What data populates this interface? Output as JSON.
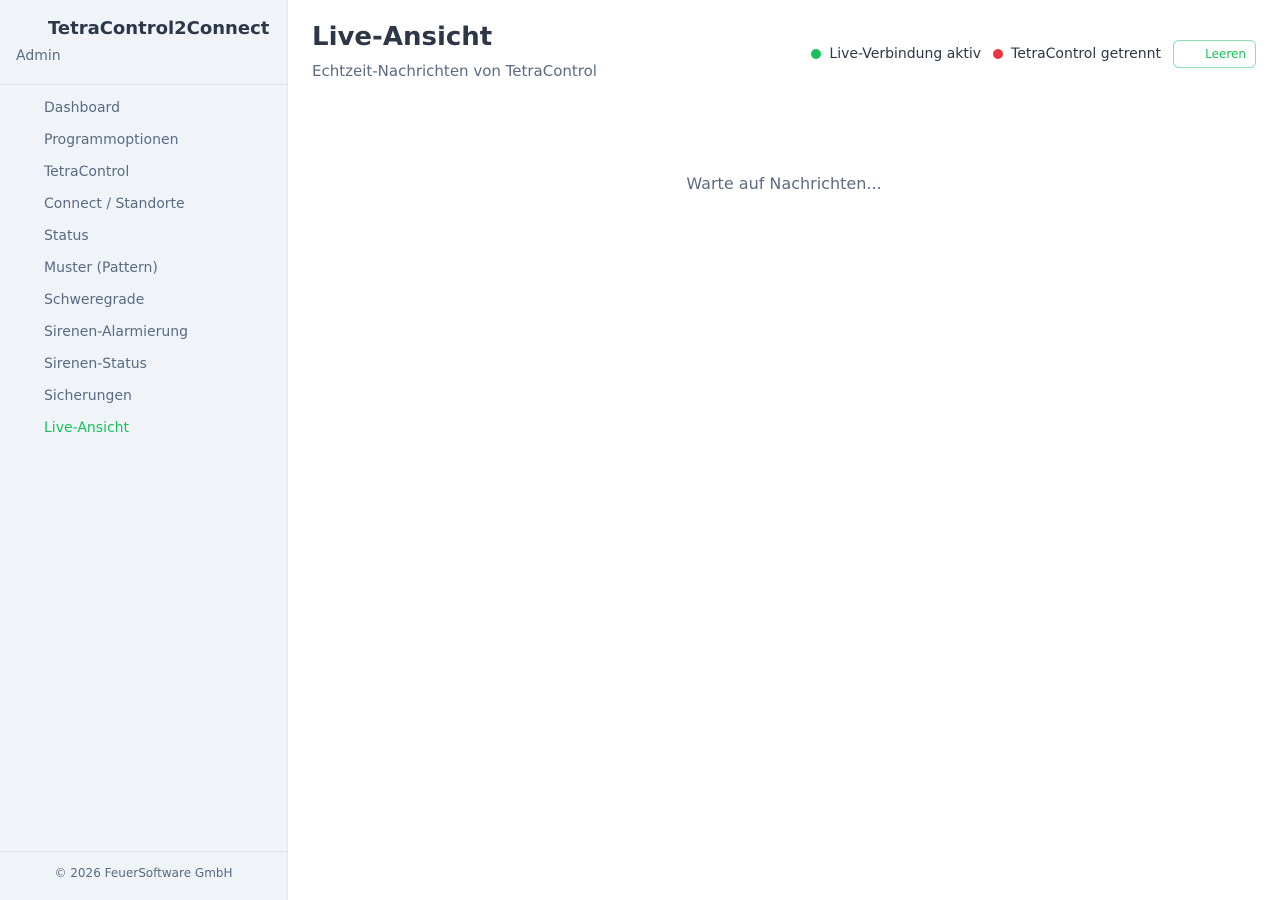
{
  "sidebar": {
    "brand_title": "TetraControl2Connect",
    "brand_subtitle": "Admin",
    "items": [
      {
        "label": "Dashboard"
      },
      {
        "label": "Programmoptionen"
      },
      {
        "label": "TetraControl"
      },
      {
        "label": "Connect / Standorte"
      },
      {
        "label": "Status"
      },
      {
        "label": "Muster (Pattern)"
      },
      {
        "label": "Schweregrade"
      },
      {
        "label": "Sirenen-Alarmierung"
      },
      {
        "label": "Sirenen-Status"
      },
      {
        "label": "Sicherungen"
      },
      {
        "label": "Live-Ansicht",
        "active": true
      }
    ],
    "footer": "© 2026 FeuerSoftware GmbH"
  },
  "header": {
    "title": "Live-Ansicht",
    "subtitle": "Echtzeit-Nachrichten von TetraControl"
  },
  "status": {
    "live": {
      "label": "Live-Verbindung aktiv",
      "color": "#16c25a"
    },
    "tetracontrol": {
      "label": "TetraControl getrennt",
      "color": "#ef3340"
    },
    "clear_label": "Leeren"
  },
  "main": {
    "waiting_text": "Warte auf Nachrichten..."
  },
  "colors": {
    "accent": "#16c25a",
    "error": "#ef3340",
    "sidebar_bg": "#f0f4f9"
  }
}
